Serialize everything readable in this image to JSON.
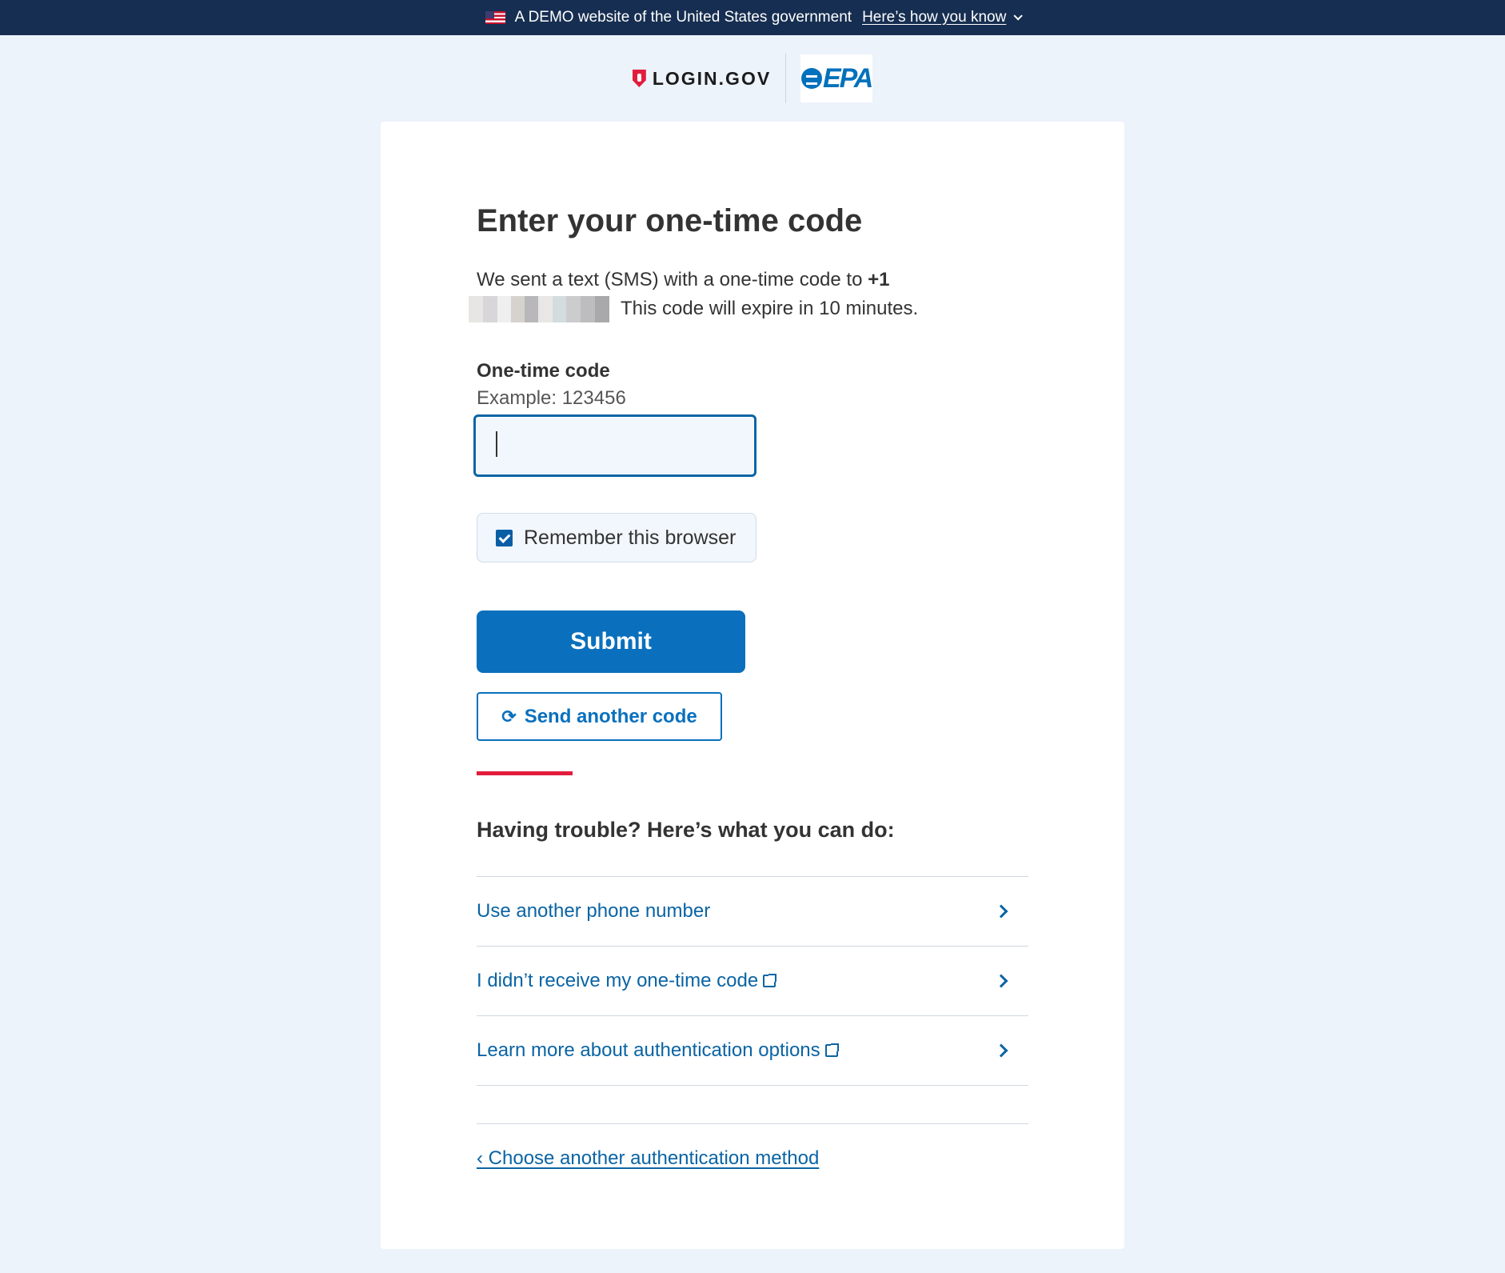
{
  "banner": {
    "text": "A DEMO website of the United States government",
    "link": "Here’s how you know"
  },
  "header": {
    "login_logo_text": "LOGIN.GOV",
    "partner_logo_text": "EPA"
  },
  "main": {
    "title": "Enter your one-time code",
    "intro_prefix": "We sent a text (SMS) with a one-time code to",
    "phone_prefix": "+1",
    "intro_suffix": "This code will expire in 10 minutes.",
    "code_label": "One-time code",
    "code_hint": "Example: 123456",
    "code_value": "",
    "remember_label": "Remember this browser",
    "remember_checked": true,
    "submit_label": "Submit",
    "resend_label": "Send another code"
  },
  "trouble": {
    "heading": "Having trouble? Here’s what you can do:",
    "options": [
      {
        "label": "Use another phone number",
        "external": false
      },
      {
        "label": "I didn’t receive my one-time code",
        "external": true
      },
      {
        "label": "Learn more about authentication options",
        "external": true
      }
    ]
  },
  "footer": {
    "back_link": "‹ Choose another authentication method"
  },
  "colors": {
    "banner_bg": "#162e51",
    "primary": "#0a70bd",
    "accent_red": "#e21c3d",
    "page_bg": "#ecf3fb"
  }
}
